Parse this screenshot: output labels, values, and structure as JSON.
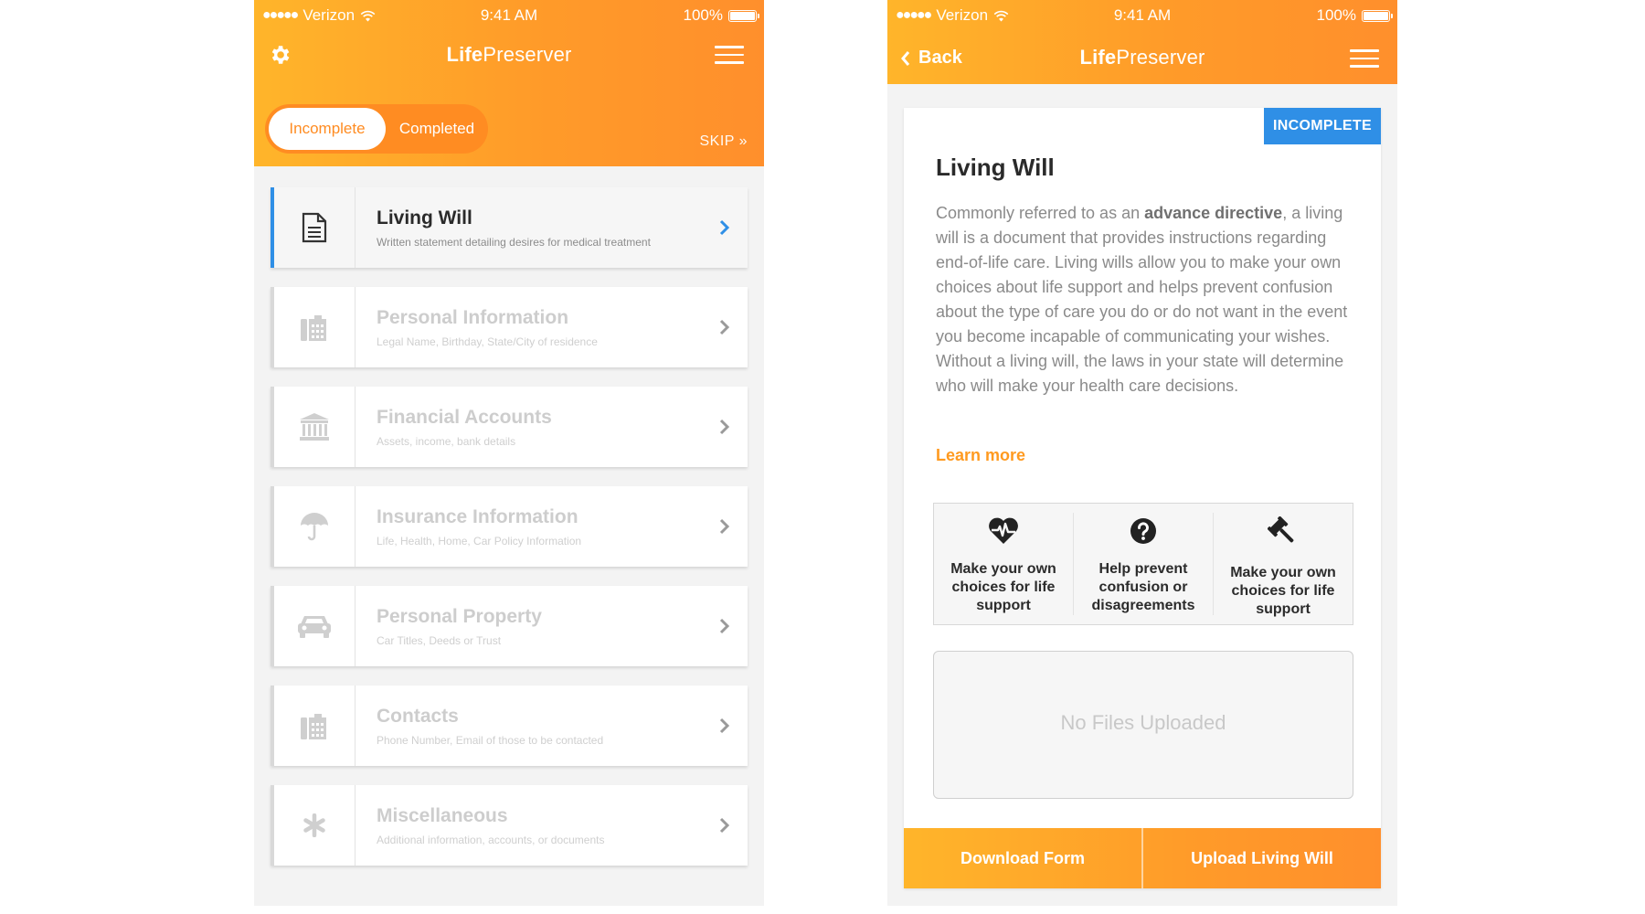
{
  "status_bar": {
    "carrier": "Verizon",
    "time": "9:41 AM",
    "battery": "100%"
  },
  "app": {
    "name_bold": "Life",
    "name_light": "Preserver"
  },
  "left_screen": {
    "toggle": {
      "active": "Incomplete",
      "inactive": "Completed"
    },
    "skip_label": "SKIP",
    "items": [
      {
        "title": "Living Will",
        "subtitle": "Written statement detailing desires for medical treatment",
        "icon": "document-icon",
        "active": true
      },
      {
        "title": "Personal Information",
        "subtitle": "Legal Name, Birthday, State/City of residence",
        "icon": "id-card-icon",
        "active": false
      },
      {
        "title": "Financial Accounts",
        "subtitle": "Assets, income, bank details",
        "icon": "bank-icon",
        "active": false
      },
      {
        "title": "Insurance Information",
        "subtitle": "Life, Health, Home, Car Policy Information",
        "icon": "umbrella-icon",
        "active": false
      },
      {
        "title": "Personal Property",
        "subtitle": "Car Titles, Deeds or Trust",
        "icon": "car-icon",
        "active": false
      },
      {
        "title": "Contacts",
        "subtitle": "Phone Number, Email of those to be contacted",
        "icon": "contacts-icon",
        "active": false
      },
      {
        "title": "Miscellaneous",
        "subtitle": "Additional information, accounts, or documents",
        "icon": "asterisk-icon",
        "active": false
      }
    ]
  },
  "right_screen": {
    "back_label": "Back",
    "badge": "INCOMPLETE",
    "title": "Living Will",
    "description_pre": "Commonly referred to as an ",
    "description_bold": "advance directive",
    "description_post": ", a living will is a document that provides instructions regarding end-of-life care. Living wills allow you to make your own choices about life support and helps prevent confusion about the type of care you do or do not want in the event you become incapable of communicating your wishes. Without a living will, the laws in your state will determine who will make your health care decisions.",
    "learn_more": "Learn more",
    "benefits": [
      {
        "icon": "heartbeat-icon",
        "text": "Make your own choices for life support"
      },
      {
        "icon": "question-icon",
        "text": "Help prevent confusion or disagreements"
      },
      {
        "icon": "gavel-icon",
        "text": "Make your own choices for life support"
      }
    ],
    "no_files": "No Files Uploaded",
    "download_label": "Download Form",
    "upload_label": "Upload Living Will"
  },
  "colors": {
    "brand_orange": "#ff9b29",
    "accent_blue": "#2f8fe6"
  }
}
